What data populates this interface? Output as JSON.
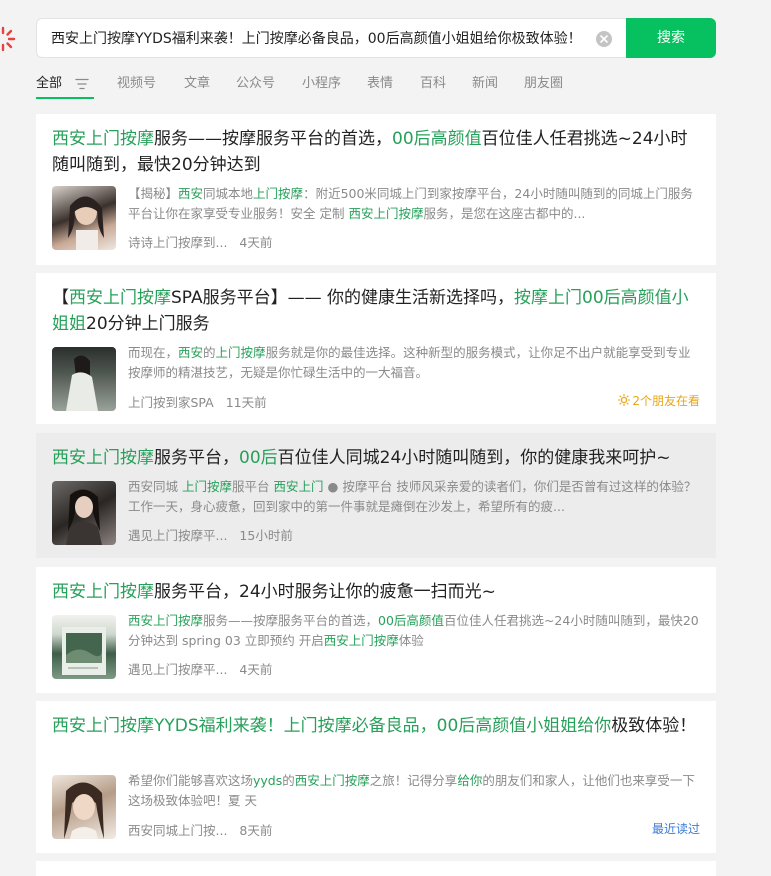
{
  "search": {
    "value": "西安上门按摩YYDS福利来袭！上门按摩必备良品，00后高颜值小姐姐给你极致体验！",
    "button_label": "搜索"
  },
  "tabs": [
    {
      "label": "全部"
    },
    {
      "label": "视频号"
    },
    {
      "label": "文章"
    },
    {
      "label": "公众号"
    },
    {
      "label": "小程序"
    },
    {
      "label": "表情"
    },
    {
      "label": "百科"
    },
    {
      "label": "新闻"
    },
    {
      "label": "朋友圈"
    }
  ],
  "colors": {
    "accent": "#07c160",
    "highlight": "#27a05a",
    "friends": "#e8a614",
    "recent": "#3a7bd5"
  },
  "results": [
    {
      "title": [
        {
          "t": "西安上门按摩",
          "hl": true
        },
        {
          "t": "服务——按摩服务平台的首选，",
          "hl": false
        },
        {
          "t": "00后高颜值",
          "hl": true
        },
        {
          "t": "百位佳人任君挑选~24小时随叫随到，最快20分钟达到",
          "hl": false
        }
      ],
      "snippet": [
        {
          "t": "【揭秘】",
          "hl": false
        },
        {
          "t": "西安",
          "hl": true
        },
        {
          "t": "同城本地",
          "hl": false
        },
        {
          "t": "上门按摩",
          "hl": true
        },
        {
          "t": "：附近500米同城上门到家按摩平台，24小时随叫随到的同城上门服务平台让你在家享受专业服务！安全 定制 ",
          "hl": false
        },
        {
          "t": "西安上门按摩",
          "hl": true
        },
        {
          "t": "服务，是您在这座古都中的...",
          "hl": false
        }
      ],
      "source": "诗诗上门按摩到...",
      "time": "4天前",
      "tag": ""
    },
    {
      "title": [
        {
          "t": "【",
          "hl": false
        },
        {
          "t": "西安上门按摩",
          "hl": true
        },
        {
          "t": "SPA服务平台】—— 你的健康生活新选择吗，",
          "hl": false
        },
        {
          "t": "按摩上门00后高颜值小姐姐",
          "hl": true
        },
        {
          "t": "20分钟上门服务",
          "hl": false
        }
      ],
      "snippet": [
        {
          "t": "而现在，",
          "hl": false
        },
        {
          "t": "西安",
          "hl": true
        },
        {
          "t": "的",
          "hl": false
        },
        {
          "t": "上门按摩",
          "hl": true
        },
        {
          "t": "服务就是你的最佳选择。这种新型的服务模式，让你足不出户就能享受到专业按摩师的精湛技艺，无疑是你忙碌生活中的一大福音。",
          "hl": false
        }
      ],
      "source": "上门按到家SPA",
      "time": "11天前",
      "tag": "2个朋友在看"
    },
    {
      "title": [
        {
          "t": "西安上门按摩",
          "hl": true
        },
        {
          "t": "服务平台，",
          "hl": false
        },
        {
          "t": "00后",
          "hl": true
        },
        {
          "t": "百位佳人同城24小时随叫随到，你的健康我来呵护~",
          "hl": false
        }
      ],
      "snippet": [
        {
          "t": "西安同城 ",
          "hl": false
        },
        {
          "t": "上门按摩",
          "hl": true
        },
        {
          "t": "服平台 ",
          "hl": false
        },
        {
          "t": "西安上门",
          "hl": true
        },
        {
          "t": " ● 按摩平台 技师风采亲爱的读者们，你们是否曾有过这样的体验？工作一天，身心疲惫，回到家中的第一件事就是瘫倒在沙发上，希望所有的疲...",
          "hl": false
        }
      ],
      "source": "遇见上门按摩平...",
      "time": "15小时前",
      "tag": ""
    },
    {
      "title": [
        {
          "t": "西安上门按摩",
          "hl": true
        },
        {
          "t": "服务平台，24小时服务让你的疲惫一扫而光~",
          "hl": false
        }
      ],
      "snippet": [
        {
          "t": "西安上门按摩",
          "hl": true
        },
        {
          "t": "服务——按摩服务平台的首选，",
          "hl": false
        },
        {
          "t": "00后高颜值",
          "hl": true
        },
        {
          "t": "百位佳人任君挑选~24小时随叫随到，最快20分钟达到 spring 03 立即预约 开启",
          "hl": false
        },
        {
          "t": "西安上门按摩",
          "hl": true
        },
        {
          "t": "体验",
          "hl": false
        }
      ],
      "source": "遇见上门按摩平...",
      "time": "4天前",
      "tag": ""
    },
    {
      "title": [
        {
          "t": "西安上门按摩YYDS福利来袭！上门按摩必备良品，00后高颜值小姐姐给你",
          "hl": true
        },
        {
          "t": "极致体验！",
          "hl": false
        }
      ],
      "snippet": [
        {
          "t": "希望你们能够喜欢这场",
          "hl": false
        },
        {
          "t": "yyds",
          "hl": true
        },
        {
          "t": "的",
          "hl": false
        },
        {
          "t": "西安上门按摩",
          "hl": true
        },
        {
          "t": "之旅！记得分享",
          "hl": false
        },
        {
          "t": "给你",
          "hl": true
        },
        {
          "t": "的朋友们和家人，让他们也来享受一下这场极致体验吧！夏 天",
          "hl": false
        }
      ],
      "source": "西安同城上门按...",
      "time": "8天前",
      "tag": "最近读过"
    }
  ]
}
